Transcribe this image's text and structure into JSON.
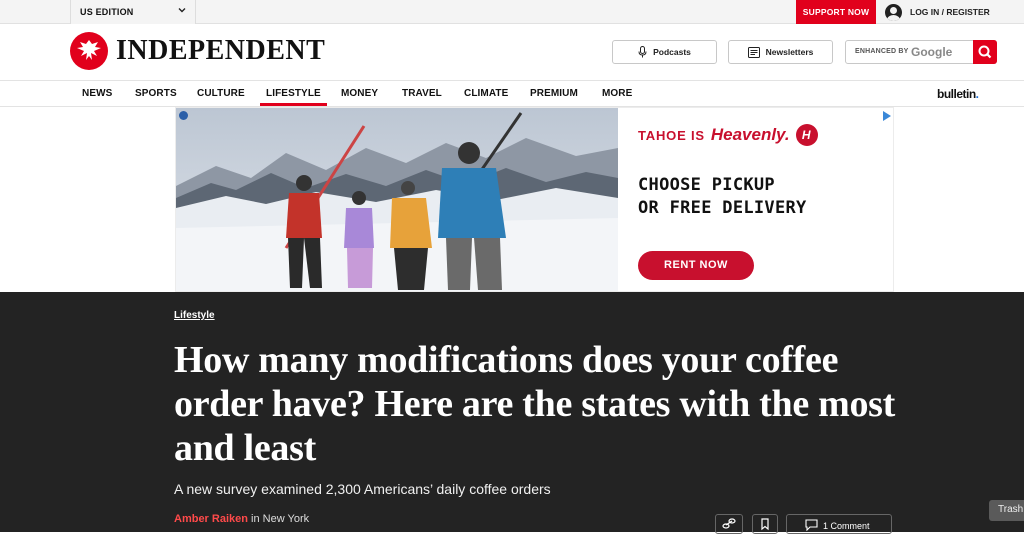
{
  "topbar": {
    "edition": "US EDITION",
    "support": "SUPPORT NOW",
    "login": "LOG IN / REGISTER"
  },
  "masthead": {
    "logo_text": "INDEPENDENT",
    "podcasts": "Podcasts",
    "newsletters": "Newsletters",
    "search_label": "ENHANCED BY",
    "search_brand": "Google"
  },
  "nav": {
    "items": [
      "NEWS",
      "SPORTS",
      "CULTURE",
      "LIFESTYLE",
      "MONEY",
      "TRAVEL",
      "CLIMATE",
      "PREMIUM",
      "MORE"
    ],
    "active": "LIFESTYLE",
    "bulletin": "bulletin",
    "bulletin_dot": "."
  },
  "ad": {
    "brand_prefix": "TAHOE IS",
    "brand_name": "Heavenly.",
    "brand_mark": "H",
    "line1": "CHOOSE PICKUP",
    "line2": "OR FREE DELIVERY",
    "cta": "RENT NOW"
  },
  "article": {
    "section": "Lifestyle",
    "headline": "How many modifications does your coffee order have? Here are the states with the most and least",
    "standfirst": "A new survey examined 2,300 Americans’ daily coffee orders",
    "author": "Amber Raiken",
    "location": " in New York",
    "comments": "1 Comment"
  },
  "dock": {
    "trash": "Trash"
  },
  "colors": {
    "brand_red": "#e1001c",
    "ad_red": "#c8102e",
    "article_bg": "#232323"
  }
}
